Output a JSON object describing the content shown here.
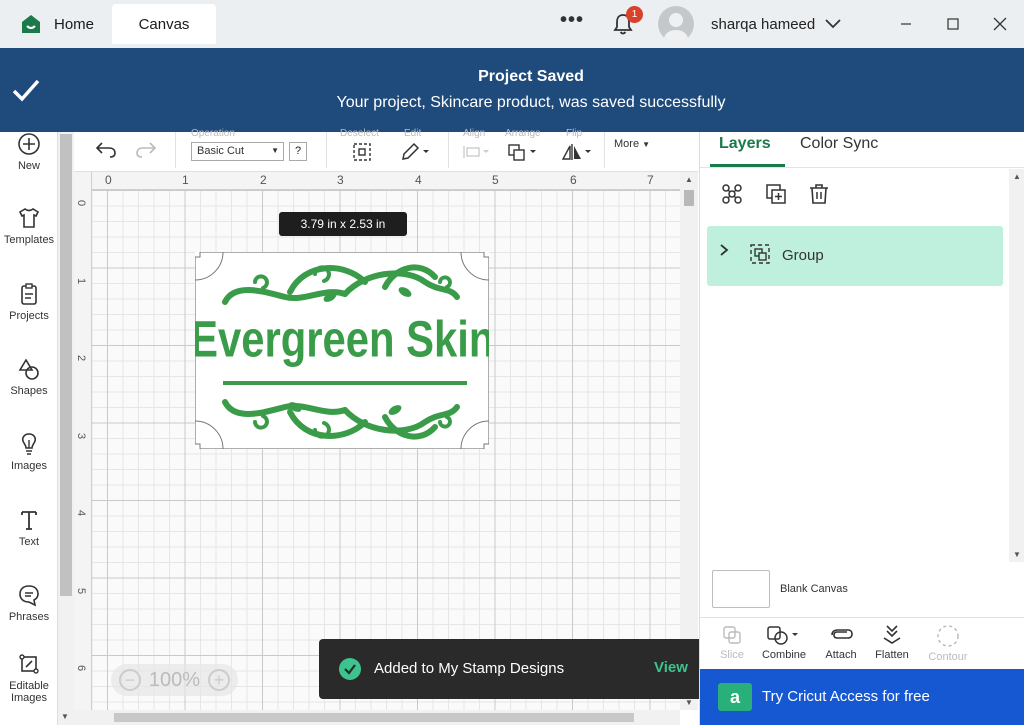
{
  "titlebar": {
    "tab_home": "Home",
    "tab_canvas": "Canvas",
    "more_dots": "•••",
    "notification_count": "1",
    "username": "sharqa hameed"
  },
  "banner": {
    "title": "Project Saved",
    "message": "Your project, Skincare product, was saved successfully"
  },
  "sidebar": {
    "items": [
      {
        "label": "New",
        "icon": "plus-circle-icon"
      },
      {
        "label": "Templates",
        "icon": "shirt-icon"
      },
      {
        "label": "Projects",
        "icon": "clipboard-icon"
      },
      {
        "label": "Shapes",
        "icon": "shapes-icon"
      },
      {
        "label": "Images",
        "icon": "lightbulb-icon"
      },
      {
        "label": "Text",
        "icon": "text-icon"
      },
      {
        "label": "Phrases",
        "icon": "chat-bubble-icon"
      },
      {
        "label": "Editable Images",
        "icon": "edit-image-icon"
      }
    ]
  },
  "toolbar": {
    "operation_label": "Operation",
    "operation_value": "Basic Cut",
    "help": "?",
    "deselect_label": "Deselect",
    "edit_label": "Edit",
    "align_label": "Align",
    "arrange_label": "Arrange",
    "flip_label": "Flip",
    "more": "More"
  },
  "canvas": {
    "ruler_top": [
      "0",
      "1",
      "2",
      "3",
      "4",
      "5",
      "6",
      "7"
    ],
    "ruler_left": [
      "0",
      "1",
      "2",
      "3",
      "4",
      "5",
      "6"
    ],
    "dimensions": "3.79  in x 2.53  in",
    "design_text": "Evergreen Skin",
    "zoom": "100%",
    "brand_green": "#3a9b48"
  },
  "toast": {
    "message": "Added to My Stamp Designs",
    "action": "View",
    "accent": "#3ec28f"
  },
  "right_panel": {
    "tabs": [
      "Layers",
      "Color Sync"
    ],
    "layer_group_label": "Group",
    "blank_canvas": "Blank Canvas",
    "tools": [
      "Slice",
      "Combine",
      "Attach",
      "Flatten",
      "Contour"
    ],
    "access_label": "Try Cricut Access for free",
    "access_icon_letter": "a",
    "access_color": "#1658d1"
  }
}
